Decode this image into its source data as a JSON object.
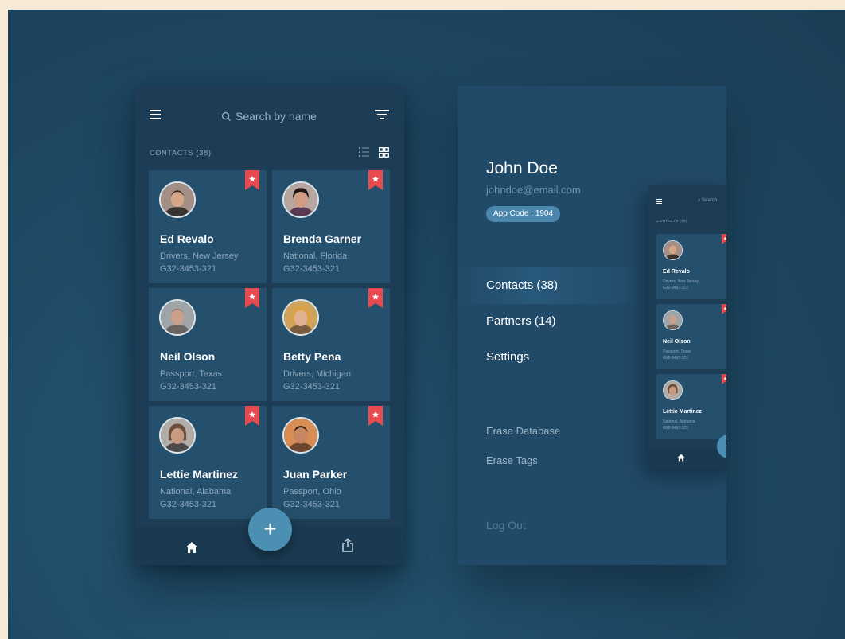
{
  "contacts_screen": {
    "search_placeholder": "Search by name",
    "contacts_label": "CONTACTS (38)",
    "cards": [
      {
        "name": "Ed Revalo",
        "group": "Drivers, New Jersey",
        "phone": "G32-3453-321",
        "skin": "#d7a688",
        "hair": "#3b2a22",
        "bg": "#a38f85"
      },
      {
        "name": "Brenda Garner",
        "group": "National, Florida",
        "phone": "G32-3453-321",
        "skin": "#d19c84",
        "hair": "#231714",
        "bg": "#b7a7a0"
      },
      {
        "name": "Neil Olson",
        "group": "Passport, Texas",
        "phone": "G32-3453-321",
        "skin": "#caa08c",
        "hair": "#8a7a70",
        "bg": "#9fa4a8"
      },
      {
        "name": "Betty Pena",
        "group": "Drivers, Michigan",
        "phone": "G32-3453-321",
        "skin": "#e1b291",
        "hair": "#d9a247",
        "bg": "#cfa35c"
      },
      {
        "name": "Lettie Martinez",
        "group": "National, Alabama",
        "phone": "G32-3453-321",
        "skin": "#c99a82",
        "hair": "#6a4f3c",
        "bg": "#b2aca6"
      },
      {
        "name": "Juan Parker",
        "group": "Passport, Ohio",
        "phone": "G32-3453-321",
        "skin": "#c58661",
        "hair": "#1e1510",
        "bg": "#d88d54"
      }
    ],
    "fab_label": "+"
  },
  "drawer": {
    "user_name": "John Doe",
    "user_email": "johndoe@email.com",
    "app_code": "App Code : 1904",
    "menu": [
      {
        "label": "Contacts (38)"
      },
      {
        "label": "Partners (14)"
      },
      {
        "label": "Settings"
      }
    ],
    "secondary": [
      {
        "label": "Erase Database"
      },
      {
        "label": "Erase Tags"
      }
    ],
    "logout": "Log Out"
  },
  "mini_screen": {
    "search_placeholder": "Search",
    "contacts_label": "CONTACTS (38)",
    "cards": [
      {
        "name": "Ed Revalo",
        "group": "Drivers, New Jersey",
        "phone": "G32-3453-321"
      },
      {
        "name": "Neil Olson",
        "group": "Passport, Texas",
        "phone": "G32-3453-321"
      },
      {
        "name": "Lettie Martinez",
        "group": "National, Alabama",
        "phone": "G32-3453-321"
      }
    ],
    "fab_label": "+"
  },
  "colors": {
    "bookmark": "#e84b4f",
    "accent": "#4b8fb3",
    "card_bg": "#25506d",
    "phone_bg": "#1c3d55"
  }
}
